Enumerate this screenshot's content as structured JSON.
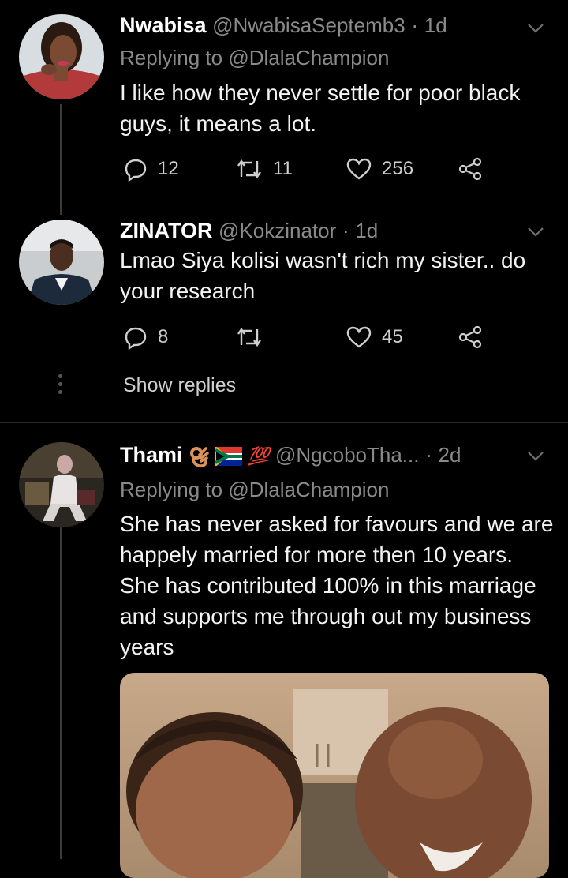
{
  "tweets": [
    {
      "name": "Nwabisa",
      "handle": "@NwabisaSeptemb3",
      "time": "1d",
      "replying_prefix": "Replying to",
      "replying_to": "@DlalaChampion",
      "text": "I like how they never settle for poor black guys, it means a lot.",
      "replies": "12",
      "retweets": "11",
      "likes": "256"
    },
    {
      "name": "ZINATOR",
      "handle": "@Kokzinator",
      "time": "1d",
      "text": "Lmao Siya kolisi wasn't rich my sister.. do your research",
      "replies": "8",
      "retweets": "",
      "likes": "45",
      "show_replies": "Show replies"
    },
    {
      "name": "Thami",
      "emoji_badge": "💯",
      "handle": "@NgcoboTha...",
      "time": "2d",
      "replying_prefix": "Replying to",
      "replying_to": "@DlalaChampion",
      "text": "She has never asked for favours and we are happely married for more then 10 years. She has contributed 100% in this marriage and supports me through out my business years"
    }
  ],
  "icons": {
    "reply": "reply-icon",
    "retweet": "retweet-icon",
    "like": "heart-icon",
    "share": "share-icon",
    "menu": "chevron-down-icon"
  },
  "colors": {
    "background": "#000000",
    "secondary_text": "#8a8a8a",
    "thread_line": "#3a3a3a"
  }
}
